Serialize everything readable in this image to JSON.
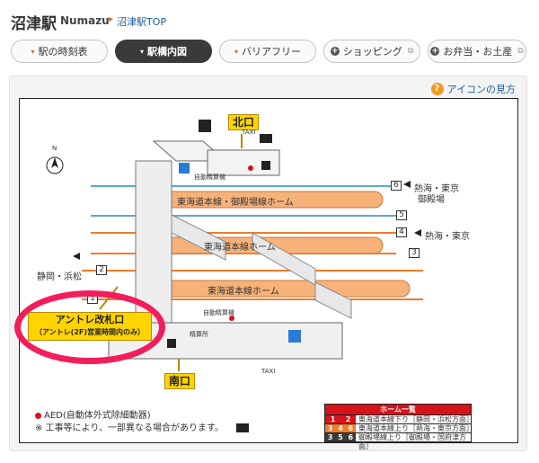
{
  "header": {
    "title": "沼津駅",
    "subtitle": "Numazu",
    "breadcrumb_link": "沼津駅TOP"
  },
  "tabs": [
    {
      "label": "駅の時刻表",
      "active": false
    },
    {
      "label": "駅構内図",
      "active": true
    },
    {
      "label": "バリアフリー",
      "active": false
    },
    {
      "label": "ショッピング",
      "active": false
    },
    {
      "label": "お弁当・お土産",
      "active": false
    }
  ],
  "panel": {
    "legend_link": "アイコンの見方"
  },
  "map": {
    "north_mark": "N",
    "exits": {
      "north": "北口",
      "south": "南口"
    },
    "gate": {
      "line1": "アントレ改札口",
      "line2": "（アントレ(2F)営業時間内のみ）"
    },
    "platforms": [
      "東海道本線・御殿場線ホーム",
      "東海道本線ホーム",
      "東海道本線ホーム"
    ],
    "tracks": [
      "6",
      "5",
      "4",
      "3",
      "2",
      "1"
    ],
    "destinations": {
      "east_top": "熱海・東京",
      "east_top_2": "御殿場",
      "east_mid": "熱海・東京",
      "west": "静岡・浜松"
    },
    "facility_labels": {
      "ticket_machine_north": "自動精算機",
      "ticket_machine_south": "自動精算機",
      "fare_adjust": "精算所",
      "taxi": "TAXI"
    },
    "notes": {
      "aed": "AED(自動体外式除細動器)",
      "construction": "※ 工事等により、一部異なる場合があります。"
    },
    "platform_table": {
      "title": "ホーム一覧",
      "rows": [
        {
          "nums": [
            "1",
            "2"
          ],
          "desc": "東海道本線下り［静岡・浜松方面］"
        },
        {
          "nums": [
            "3",
            "4",
            "6"
          ],
          "desc": "東海道本線上り［熱海・東京方面］"
        },
        {
          "nums": [
            "3",
            "5",
            "6"
          ],
          "desc": "御殿場線上り［御殿場・国府津方面］"
        }
      ]
    }
  },
  "colors": {
    "accent_orange": "#e3611a",
    "platform_fill": "#f7b27a",
    "rail_orange": "#f07b2c",
    "rail_blue": "#5aa9d6",
    "highlight": "#f21e5b",
    "aed_red": "#d6121a"
  }
}
